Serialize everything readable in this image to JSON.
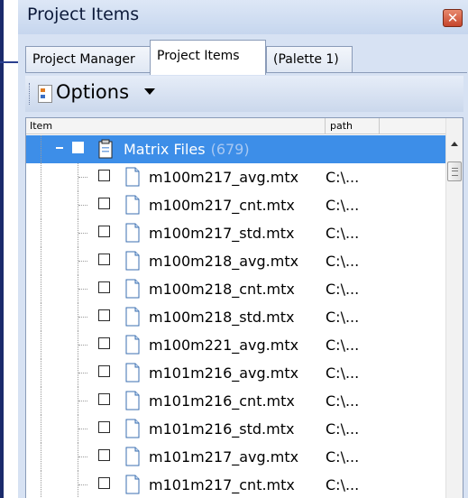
{
  "window": {
    "title": "Project Items",
    "close_icon": "close-icon",
    "close_symbol": "✕"
  },
  "tabs": [
    {
      "label": "Project Manager",
      "active": false
    },
    {
      "label": "Project Items",
      "active": true
    },
    {
      "label": "(Palette 1)",
      "active": false
    }
  ],
  "toolbar": {
    "options_label": "Options",
    "options_icon": "options-icon"
  },
  "tree": {
    "columns": {
      "item": "Item",
      "path": "path"
    },
    "group": {
      "label": "Matrix Files",
      "count": "(679)",
      "expanded": true,
      "checked": false
    },
    "files": [
      {
        "name": "m100m217_avg.mtx",
        "path": "C:\\..."
      },
      {
        "name": "m100m217_cnt.mtx",
        "path": "C:\\..."
      },
      {
        "name": "m100m217_std.mtx",
        "path": "C:\\..."
      },
      {
        "name": "m100m218_avg.mtx",
        "path": "C:\\..."
      },
      {
        "name": "m100m218_cnt.mtx",
        "path": "C:\\..."
      },
      {
        "name": "m100m218_std.mtx",
        "path": "C:\\..."
      },
      {
        "name": "m100m221_avg.mtx",
        "path": "C:\\..."
      },
      {
        "name": "m101m216_avg.mtx",
        "path": "C:\\..."
      },
      {
        "name": "m101m216_cnt.mtx",
        "path": "C:\\..."
      },
      {
        "name": "m101m216_std.mtx",
        "path": "C:\\..."
      },
      {
        "name": "m101m217_avg.mtx",
        "path": "C:\\..."
      },
      {
        "name": "m101m217_cnt.mtx",
        "path": "C:\\..."
      }
    ]
  },
  "colors": {
    "selection": "#3d8ee8",
    "title_close": "#c6452c",
    "panel": "#d7e2f3"
  }
}
